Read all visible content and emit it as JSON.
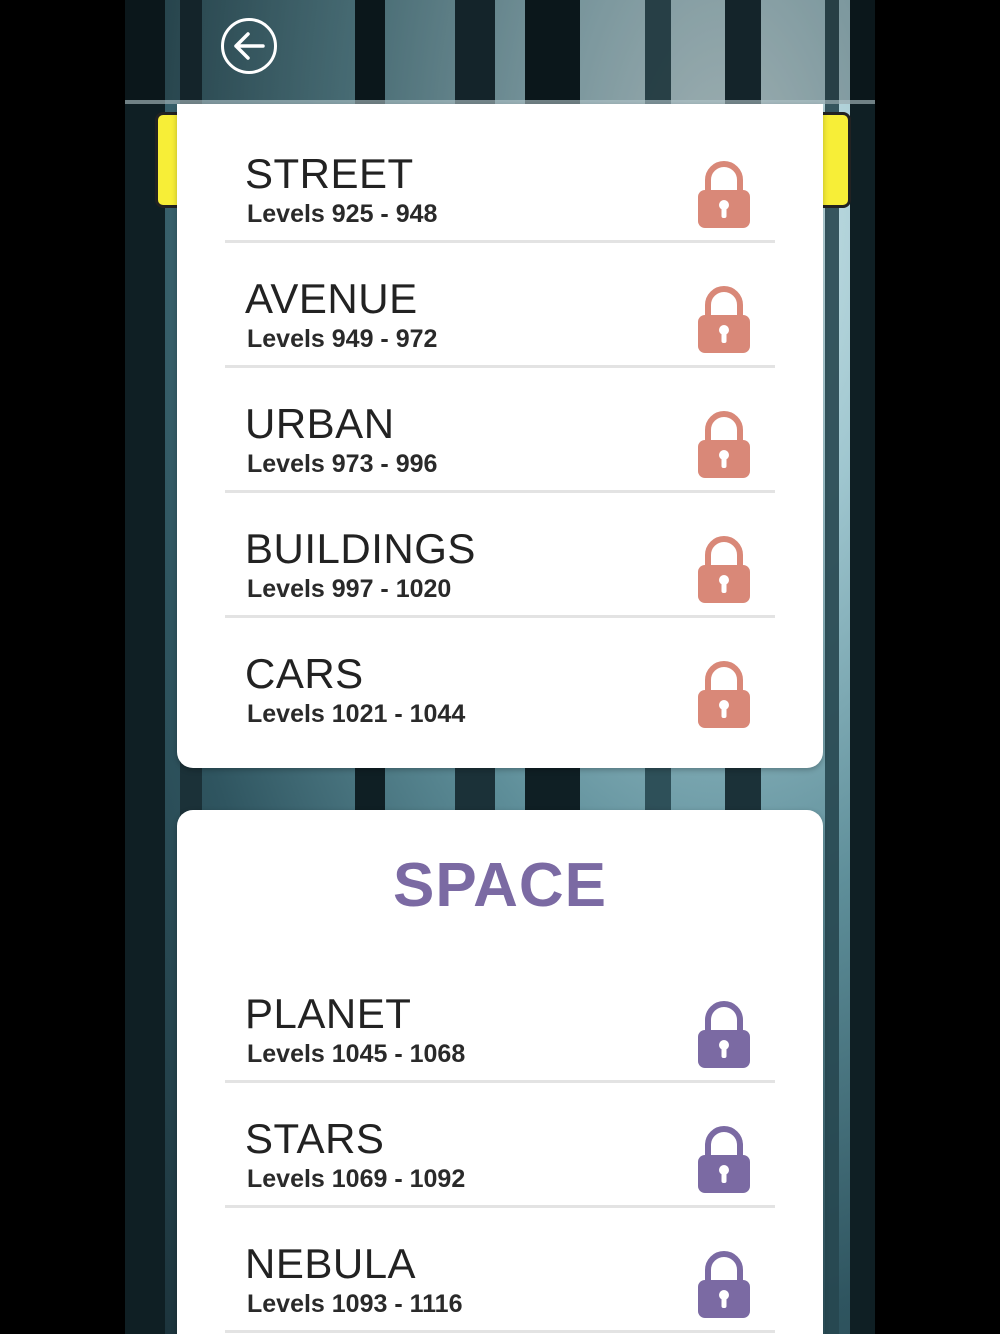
{
  "colors": {
    "city_lock": "#d98878",
    "space_lock": "#7b6aa3",
    "space_title": "#7b6aa3",
    "tab_yellow": "#f7ee37"
  },
  "header": {
    "back_icon": "back-arrow-icon"
  },
  "city_pack": {
    "items": [
      {
        "name": "STREET",
        "levels": "Levels 925 - 948",
        "locked": true
      },
      {
        "name": "AVENUE",
        "levels": "Levels 949 - 972",
        "locked": true
      },
      {
        "name": "URBAN",
        "levels": "Levels 973 - 996",
        "locked": true
      },
      {
        "name": "BUILDINGS",
        "levels": "Levels 997 - 1020",
        "locked": true
      },
      {
        "name": "CARS",
        "levels": "Levels 1021 - 1044",
        "locked": true
      }
    ]
  },
  "space_pack": {
    "title": "SPACE",
    "items": [
      {
        "name": "PLANET",
        "levels": "Levels 1045 - 1068",
        "locked": true
      },
      {
        "name": "STARS",
        "levels": "Levels 1069 - 1092",
        "locked": true
      },
      {
        "name": "NEBULA",
        "levels": "Levels 1093 - 1116",
        "locked": true
      }
    ]
  }
}
